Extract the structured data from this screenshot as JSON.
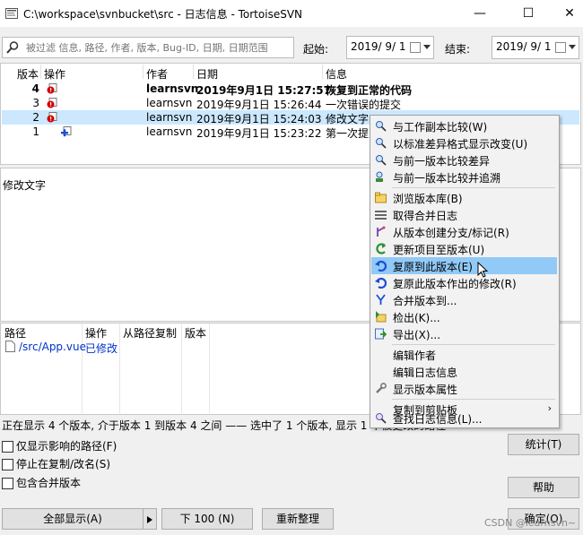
{
  "window": {
    "title": "C:\\workspace\\svnbucket\\src - 日志信息 - TortoiseSVN",
    "minimize": "—",
    "maximize": "☐",
    "close": "✕"
  },
  "filter": {
    "placeholder": "被过滤 信息, 路径, 作者, 版本, Bug-ID, 日期, 日期范围",
    "from_label": "起始:",
    "from_date": "2019/ 9/ 1",
    "to_label": "结束:",
    "to_date": "2019/ 9/ 1"
  },
  "revlist": {
    "headers": [
      "版本",
      "操作",
      "作者",
      "日期",
      "信息"
    ],
    "rows": [
      {
        "rev": "4",
        "author": "learnsvn",
        "date": "2019年9月1日 15:27:57",
        "message": "恢复到正常的代码",
        "bold": true
      },
      {
        "rev": "3",
        "author": "learnsvn",
        "date": "2019年9月1日 15:26:44",
        "message": "一次错误的提交",
        "bold": false
      },
      {
        "rev": "2",
        "author": "learnsvn",
        "date": "2019年9月1日 15:24:03",
        "message": "修改文字",
        "bold": false
      },
      {
        "rev": "1",
        "author": "learnsvn",
        "date": "2019年9月1日 15:23:22",
        "message": "第一次提交",
        "bold": false
      }
    ]
  },
  "message": {
    "text": "修改文字"
  },
  "paths": {
    "headers": [
      "路径",
      "操作",
      "从路径复制",
      "版本"
    ],
    "rows": [
      {
        "path": "/src/App.vue",
        "action": "已修改"
      }
    ]
  },
  "status": {
    "text": "正在显示 4 个版本, 介于版本 1 到版本 4 之间 —— 选中了 1 个版本, 显示 1 个被更改的路径"
  },
  "options": {
    "affected_only": "仅显示影响的路径(F)",
    "stop_on_copy": "停止在复制/改名(S)",
    "include_merged": "包含合并版本"
  },
  "buttons": {
    "show_all": "全部显示(A)",
    "next_100": "下 100 (N)",
    "refresh": "重新整理",
    "stats": "统计(T)",
    "help": "帮助",
    "ok": "确定(O)"
  },
  "context_menu": {
    "items": [
      {
        "label": "与工作副本比较(W)",
        "icon": "compare-icon"
      },
      {
        "label": "以标准差异格式显示改变(U)",
        "icon": "diff-icon"
      },
      {
        "label": "与前一版本比较差异",
        "icon": "compare-previous-icon"
      },
      {
        "label": "与前一版本比较并追溯",
        "icon": "blame-icon"
      },
      {
        "label": "浏览版本库(B)",
        "icon": "repo-browser-icon"
      },
      {
        "label": "取得合并日志",
        "icon": "merge-log-icon"
      },
      {
        "label": "从版本创建分支/标记(R)",
        "icon": "branch-icon"
      },
      {
        "label": "更新项目至版本(U)",
        "icon": "update-icon"
      },
      {
        "label": "复原到此版本(E)",
        "icon": "revert-icon"
      },
      {
        "label": "复原此版本作出的修改(R)",
        "icon": "revert-changes-icon"
      },
      {
        "label": "合并版本到...",
        "icon": "merge-icon"
      },
      {
        "label": "检出(K)...",
        "icon": "checkout-icon"
      },
      {
        "label": "导出(X)...",
        "icon": "export-icon"
      },
      {
        "label": "编辑作者",
        "icon": ""
      },
      {
        "label": "编辑日志信息",
        "icon": ""
      },
      {
        "label": "显示版本属性",
        "icon": "wrench-icon"
      },
      {
        "label": "复制到剪贴板",
        "icon": ""
      },
      {
        "label": "查找日志信息(L)...",
        "icon": "find-icon"
      }
    ]
  },
  "watermark": {
    "text": "CSDN @learnsvn~"
  },
  "colors": {
    "selection": "#cce8ff",
    "menu_highlight": "#91c9f7",
    "link_blue": "#0033cc"
  }
}
